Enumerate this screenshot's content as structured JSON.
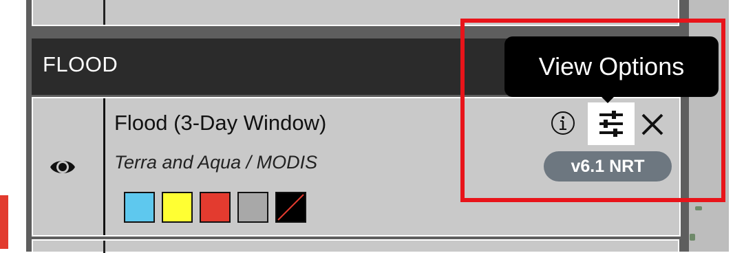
{
  "category": {
    "title": "FLOOD",
    "collapsed_indicator": "…"
  },
  "layer": {
    "title": "Flood (3-Day Window)",
    "subtitle": "Terra and Aqua / MODIS",
    "version_badge": "v6.1 NRT",
    "visibility_icon": "eye-icon",
    "legend_colors": [
      "#5ec8ee",
      "#ffff33",
      "#e33b2f",
      "#a8a8a8",
      "nodata"
    ]
  },
  "tooltip": {
    "text": "View Options"
  },
  "colors": {
    "header_bg": "#2b2b2b",
    "row_bg": "#c9c9c9",
    "badge_bg": "#6d7780",
    "highlight": "#e8141a"
  }
}
